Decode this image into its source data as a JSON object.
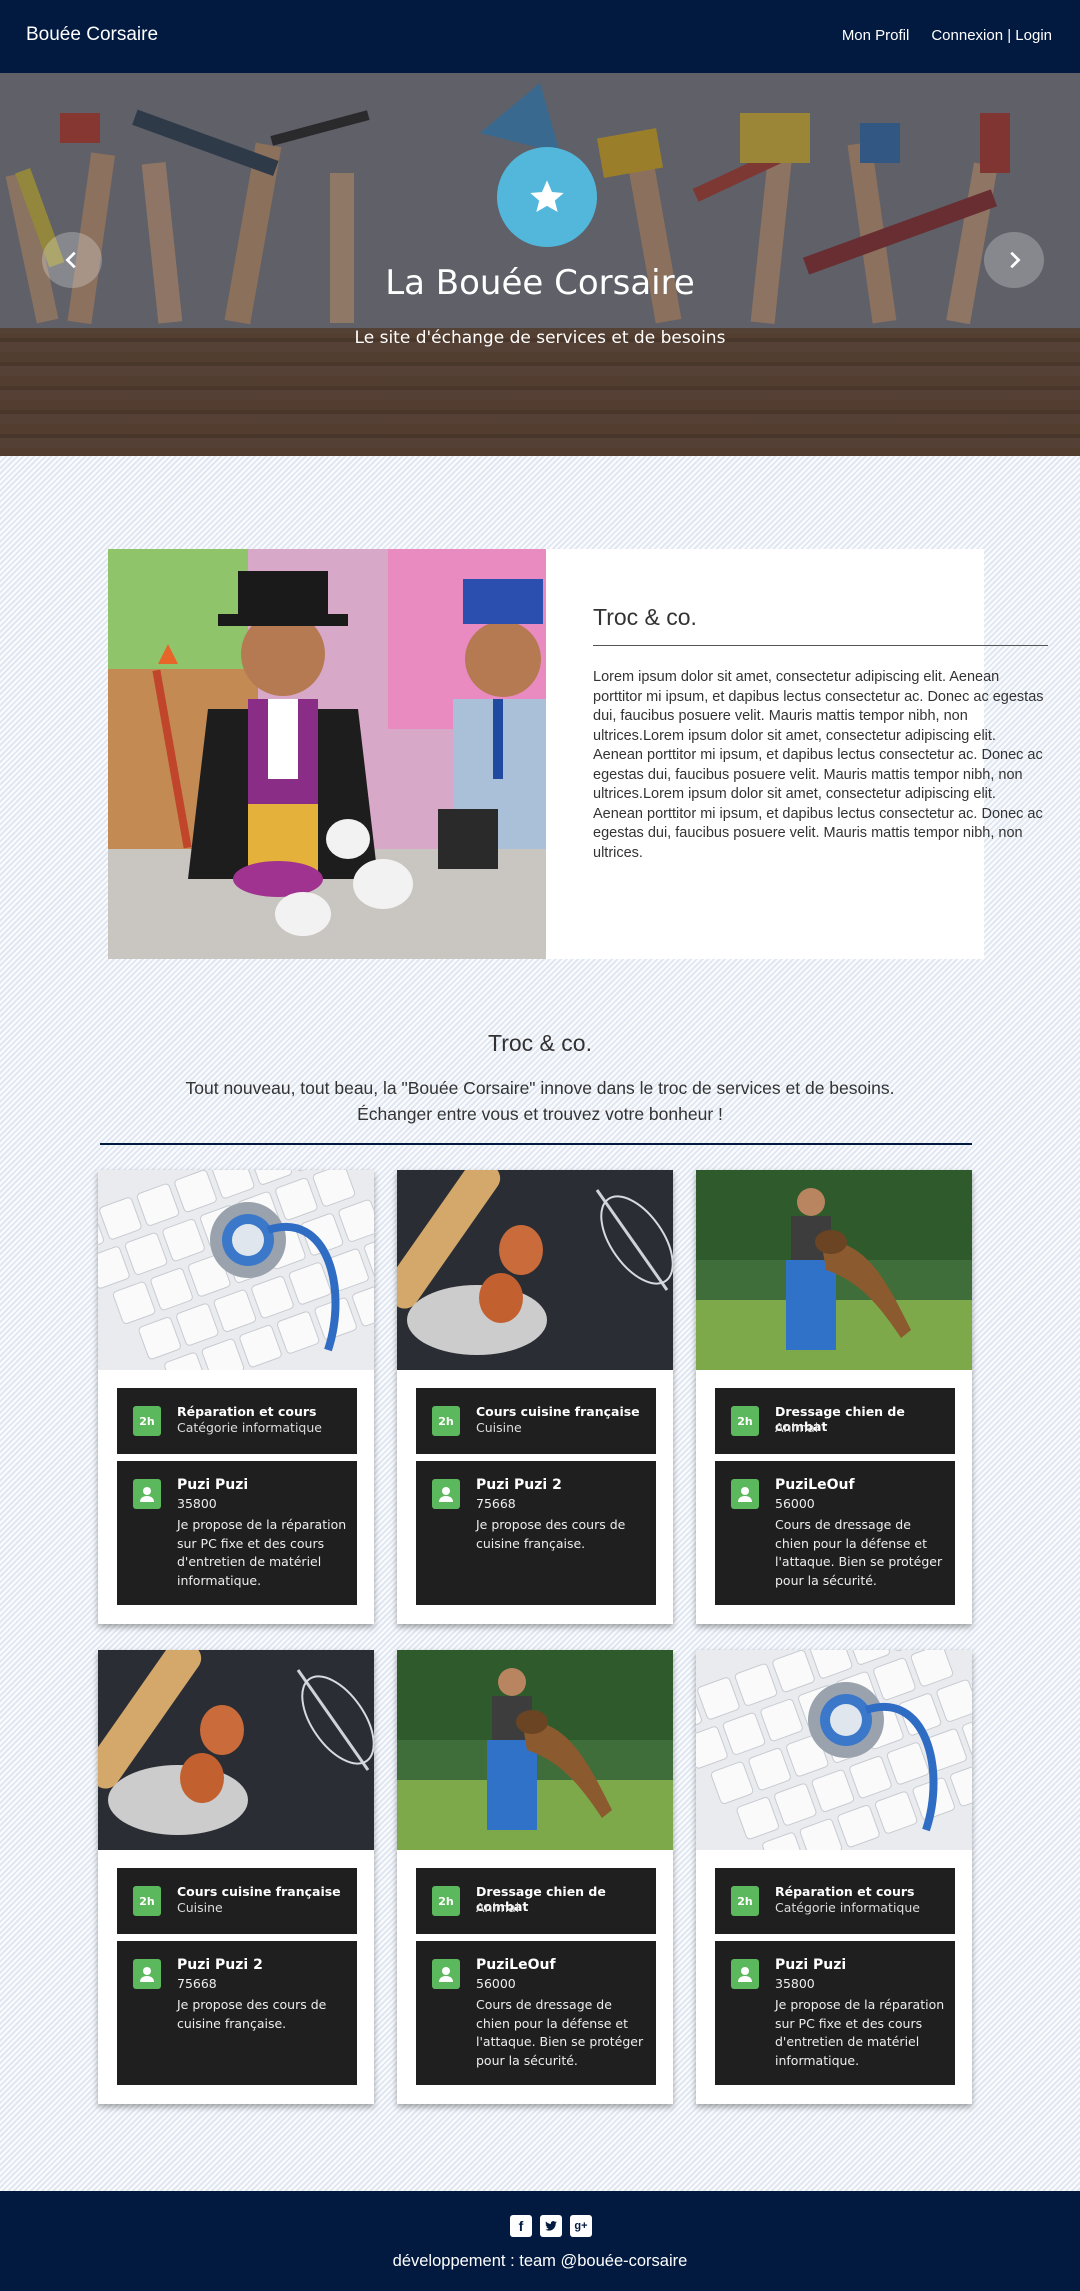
{
  "navbar": {
    "brand": "Bouée Corsaire",
    "links": [
      "Mon Profil",
      "Connexion | Login"
    ]
  },
  "hero": {
    "title": "La Bouée Corsaire",
    "subtitle": "Le site d'échange de services et de besoins",
    "icon": "star-icon"
  },
  "feature": {
    "title": "Troc & co.",
    "body": "Lorem ipsum dolor sit amet, consectetur adipiscing elit. Aenean porttitor mi ipsum, et dapibus lectus consectetur ac. Donec ac egestas dui, faucibus posuere velit. Mauris mattis tempor nibh, non ultrices.Lorem ipsum dolor sit amet, consectetur adipiscing elit. Aenean porttitor mi ipsum, et dapibus lectus consectetur ac. Donec ac egestas dui, faucibus posuere velit. Mauris mattis tempor nibh, non ultrices.Lorem ipsum dolor sit amet, consectetur adipiscing elit. Aenean porttitor mi ipsum, et dapibus lectus consectetur ac. Donec ac egestas dui, faucibus posuere velit. Mauris mattis tempor nibh, non ultrices."
  },
  "section": {
    "title": "Troc & co.",
    "line1": "Tout nouveau, tout beau, la \"Bouée Corsaire\" innove dans le troc de services et de besoins.",
    "line2": "Échanger entre vous et trouvez votre bonheur !"
  },
  "cards": [
    {
      "image": "keyboard-stethoscope",
      "duration": "2h",
      "title": "Réparation et cours",
      "category": "Catégorie informatique",
      "user": "Puzi Puzi",
      "zip": "35800",
      "description": "Je propose de la réparation sur PC fixe et des cours d'entretien de matériel informatique."
    },
    {
      "image": "baking-eggs",
      "duration": "2h",
      "title": "Cours cuisine française",
      "category": "Cuisine",
      "user": "Puzi Puzi 2",
      "zip": "75668",
      "description": "Je propose des cours de cuisine française."
    },
    {
      "image": "dog-training",
      "duration": "2h",
      "title": "Dressage chien de combat",
      "category": "Animal",
      "user": "PuziLeOuf",
      "zip": "56000",
      "description": "Cours de dressage de chien pour la défense et l'attaque. Bien se protéger pour la sécurité."
    },
    {
      "image": "baking-eggs",
      "duration": "2h",
      "title": "Cours cuisine française",
      "category": "Cuisine",
      "user": "Puzi Puzi 2",
      "zip": "75668",
      "description": "Je propose des cours de cuisine française."
    },
    {
      "image": "dog-training",
      "duration": "2h",
      "title": "Dressage chien de combat",
      "category": "Animal",
      "user": "PuziLeOuf",
      "zip": "56000",
      "description": "Cours de dressage de chien pour la défense et l'attaque. Bien se protéger pour la sécurité."
    },
    {
      "image": "keyboard-stethoscope",
      "duration": "2h",
      "title": "Réparation et cours",
      "category": "Catégorie informatique",
      "user": "Puzi Puzi",
      "zip": "35800",
      "description": "Je propose de la réparation sur PC fixe et des cours d'entretien de matériel informatique."
    }
  ],
  "footer": {
    "social": [
      "facebook-icon",
      "twitter-icon",
      "google-plus-icon"
    ],
    "text": "développement : team @bouée-corsaire"
  },
  "colors": {
    "navbar": "#021a40",
    "accent": "#53b7dc",
    "badge": "#5cb85c",
    "card_panel": "#1f1f1f"
  }
}
